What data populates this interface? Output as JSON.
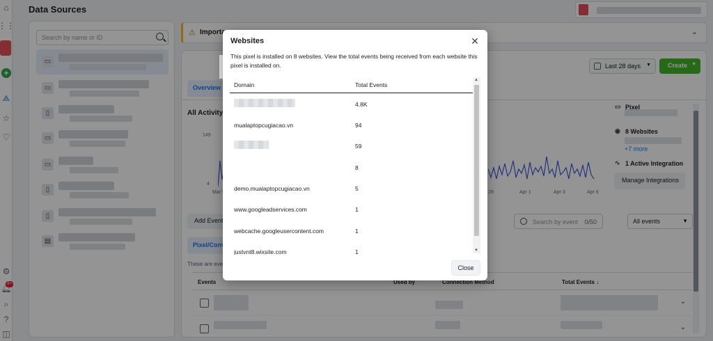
{
  "page": {
    "title": "Data Sources"
  },
  "left_panel": {
    "search_placeholder": "Search by name or ID"
  },
  "notice": {
    "label": "Importan"
  },
  "main": {
    "tab_overview": "Overview",
    "date_range": "Last 28 days",
    "create_label": "Create",
    "activity_title": "All Activity",
    "y_max": "149",
    "y_min": "4",
    "x_labels": [
      "Mar 5",
      "r 29",
      "Apr 1",
      "Apr 3",
      "Apr 6"
    ],
    "side": {
      "pixel_label": "Pixel",
      "websites_label": "8 Websites",
      "more_link": "+7 more",
      "integration_label": "1 Active Integration",
      "manage_label": "Manage Integrations"
    },
    "add_events": "Add Events",
    "event_search_placeholder": "Search by event",
    "event_search_count": "0/50",
    "all_events": "All events",
    "pixel_tab": "Pixel/Conv",
    "these_text": "These are eve",
    "table_headers": [
      "Events",
      "Used by",
      "Connection Method",
      "Total Events ↓"
    ]
  },
  "modal": {
    "title": "Websites",
    "description": "This pixel is installed on 8 websites. View the total events being received from each website this pixel is installed on.",
    "col_domain": "Domain",
    "col_events": "Total Events",
    "rows": [
      {
        "domain": "",
        "redacted": true,
        "events": "4.8K"
      },
      {
        "domain": "mualaptopcugiacao.vn",
        "events": "94"
      },
      {
        "domain": "",
        "redacted": true,
        "events": "59"
      },
      {
        "domain": "",
        "events": "8"
      },
      {
        "domain": "demo.mualaptopcugiacao.vn",
        "events": "5"
      },
      {
        "domain": "www.googleadservices.com",
        "events": "1"
      },
      {
        "domain": "webcache.googleusercontent.com",
        "events": "1"
      },
      {
        "domain": "justvnt8.wixsite.com",
        "events": "1"
      }
    ],
    "close_label": "Close"
  },
  "colors": {
    "accent": "#1877f2",
    "create": "#42b72a",
    "overlay": "rgba(0,0,0,0.42)"
  }
}
